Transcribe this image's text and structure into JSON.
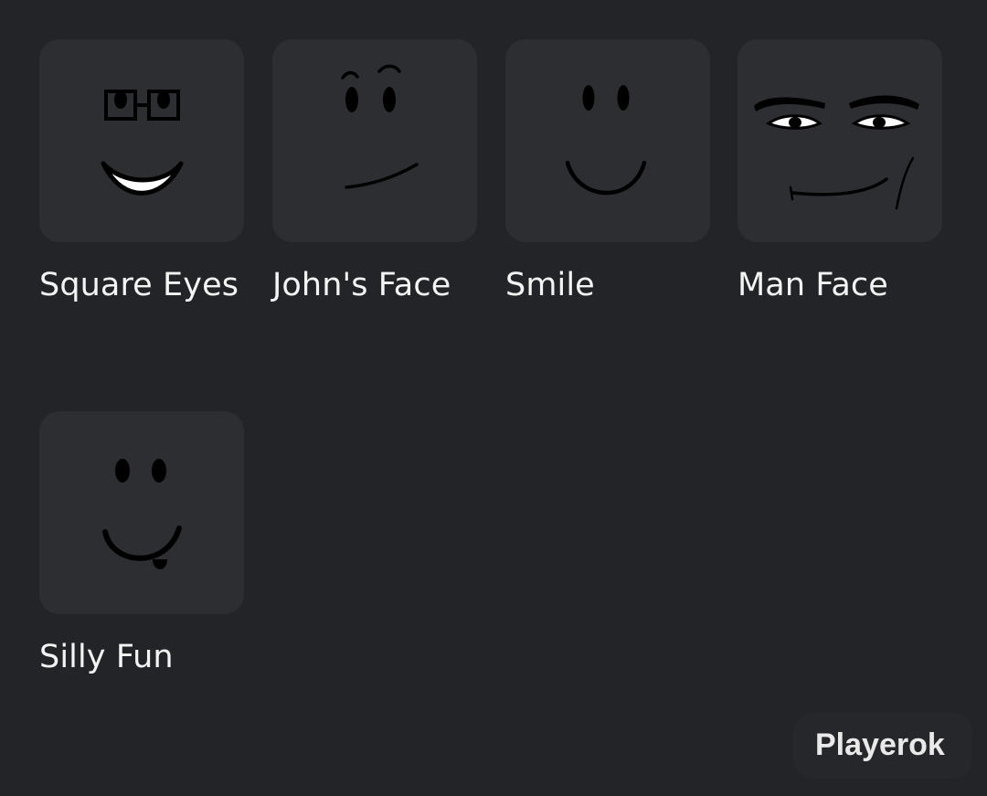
{
  "items": [
    {
      "name": "Square Eyes",
      "icon": "square-eyes-face-icon"
    },
    {
      "name": "John's Face",
      "icon": "johns-face-icon"
    },
    {
      "name": "Smile",
      "icon": "smile-face-icon"
    },
    {
      "name": "Man Face",
      "icon": "man-face-icon"
    },
    {
      "name": "Silly Fun",
      "icon": "silly-fun-face-icon"
    }
  ],
  "watermark": {
    "text": "Playerok"
  },
  "colors": {
    "background": "#232427",
    "tile": "#2d2e32",
    "text": "#f4f4f5"
  }
}
